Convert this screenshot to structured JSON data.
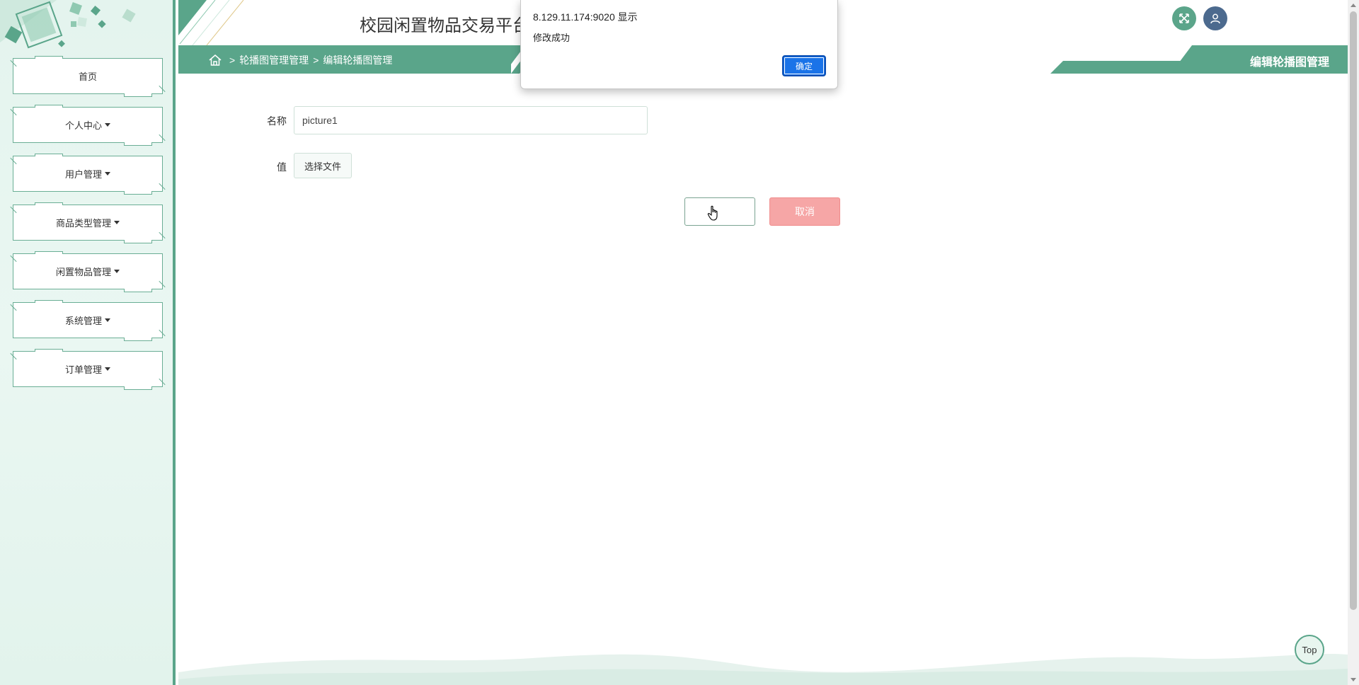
{
  "header": {
    "site_title": "校园闲置物品交易平台"
  },
  "sidebar": {
    "items": [
      {
        "label": "首页",
        "dropdown": false
      },
      {
        "label": "个人中心",
        "dropdown": true
      },
      {
        "label": "用户管理",
        "dropdown": true
      },
      {
        "label": "商品类型管理",
        "dropdown": true
      },
      {
        "label": "闲置物品管理",
        "dropdown": true
      },
      {
        "label": "系统管理",
        "dropdown": true
      },
      {
        "label": "订单管理",
        "dropdown": true
      }
    ]
  },
  "breadcrumb": {
    "sep1": ">",
    "level1": "轮播图管理管理",
    "sep2": ">",
    "level2": "编辑轮播图管理"
  },
  "page_heading": "编辑轮播图管理",
  "form": {
    "name_label": "名称",
    "name_value": "picture1",
    "value_label": "值",
    "file_button": "选择文件",
    "submit_label": "",
    "cancel_label": "取消"
  },
  "dialog": {
    "title": "8.129.11.174:9020 显示",
    "message": "修改成功",
    "ok_label": "确定"
  },
  "top_button": "Top",
  "colors": {
    "accent": "#5aa58a",
    "cancel": "#f6a6a6",
    "dialog_ok": "#1a73e8"
  }
}
